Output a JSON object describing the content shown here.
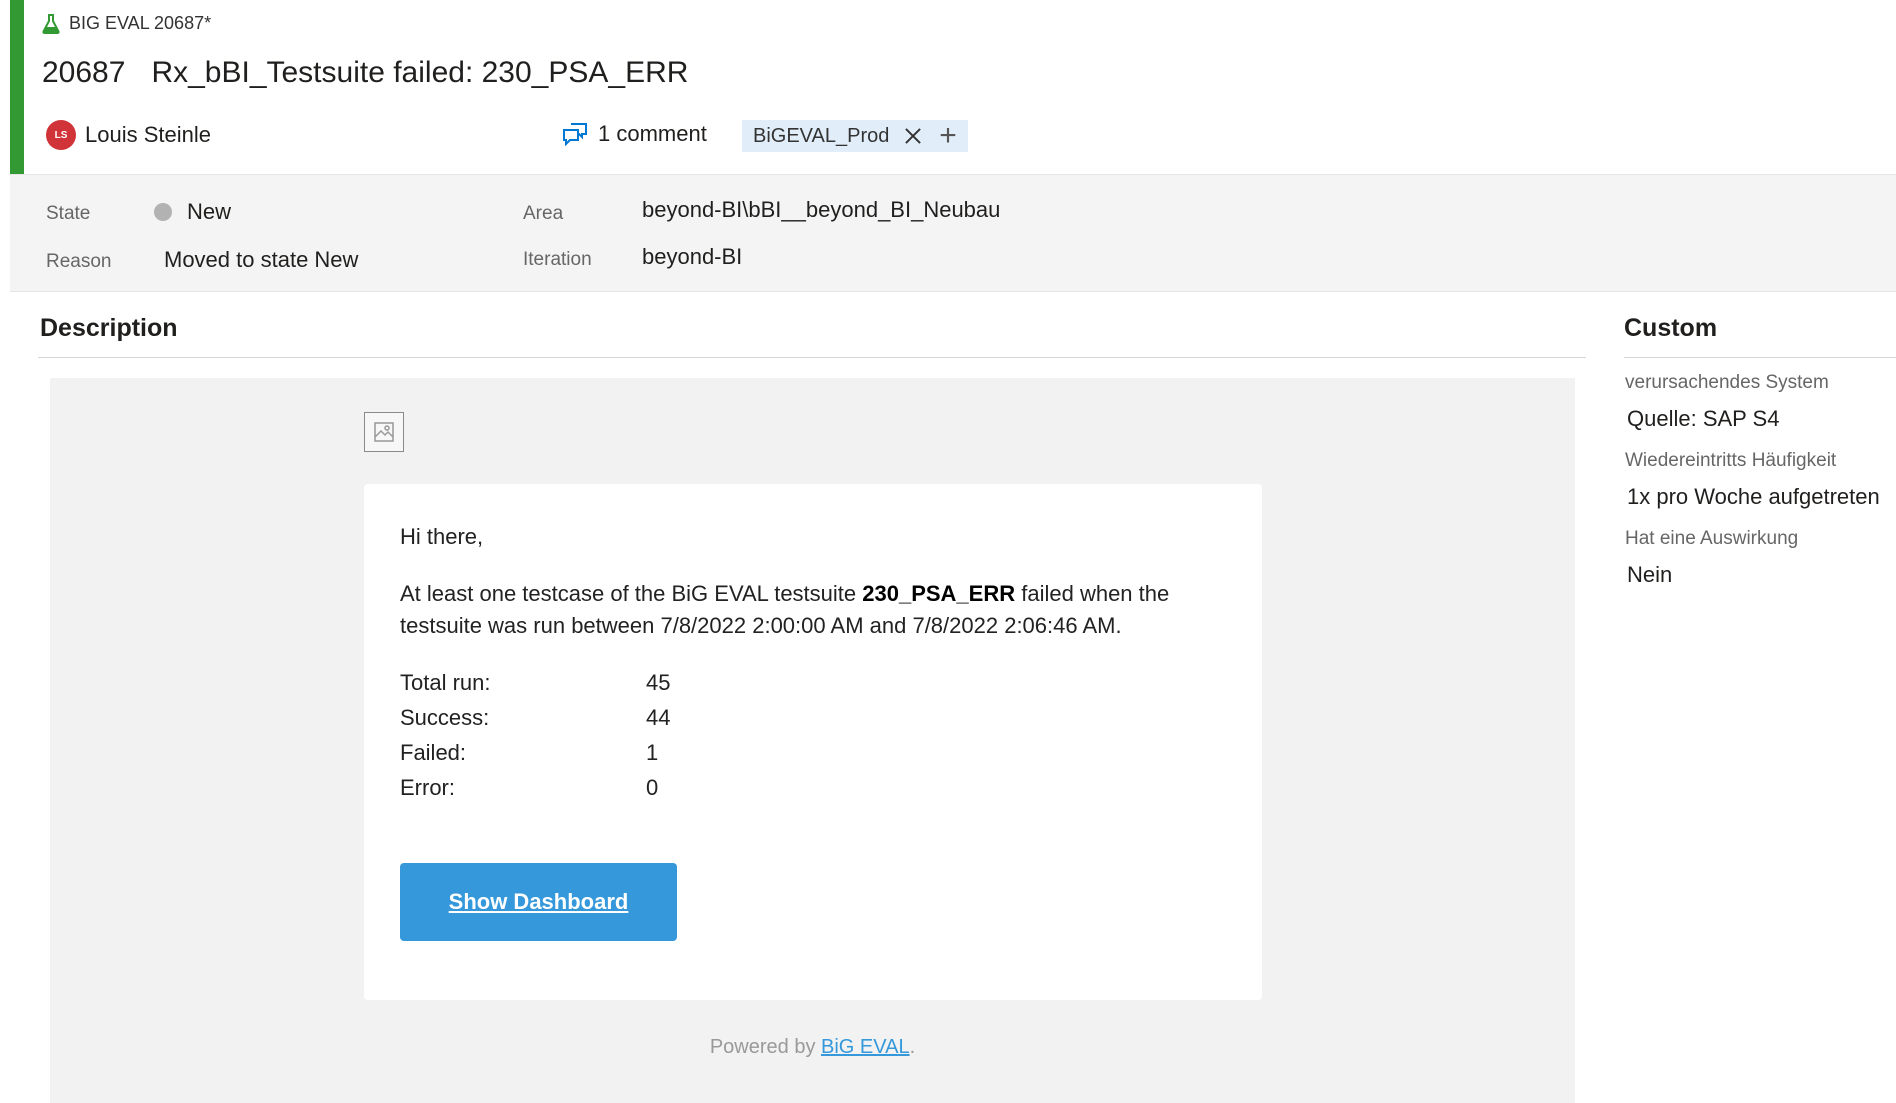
{
  "header": {
    "work_item_type_label": "BIG EVAL 20687*",
    "id": "20687",
    "title": "Rx_bBI_Testsuite failed: 230_PSA_ERR",
    "assignee_initials": "LS",
    "assignee": "Louis Steinle",
    "comments_label": "1 comment",
    "tags": [
      "BiGEVAL_Prod"
    ],
    "add_tag_label": "+"
  },
  "fields": {
    "state_label": "State",
    "state_value": "New",
    "reason_label": "Reason",
    "reason_value": "Moved to state New",
    "area_label": "Area",
    "area_value": "beyond-BI\\bBI__beyond_BI_Neubau",
    "iteration_label": "Iteration",
    "iteration_value": "beyond-BI"
  },
  "description": {
    "section_title": "Description",
    "greeting": "Hi there,",
    "summary_pre": "At least one testcase of the BiG EVAL testsuite ",
    "summary_bold": "230_PSA_ERR",
    "summary_post": " failed when the testsuite was run between 7/8/2022 2:00:00 AM and 7/8/2022 2:06:46 AM.",
    "stats": [
      {
        "label": "Total run:",
        "value": "45"
      },
      {
        "label": "Success:",
        "value": "44"
      },
      {
        "label": "Failed:",
        "value": "1"
      },
      {
        "label": "Error:",
        "value": "0"
      }
    ],
    "button_label": "Show Dashboard",
    "powered_prefix": "Powered by ",
    "powered_link": "BiG EVAL",
    "powered_suffix": "."
  },
  "custom": {
    "section_title": "Custom",
    "fields": [
      {
        "label": "verursachendes System",
        "value": "Quelle: SAP S4"
      },
      {
        "label": "Wiedereintritts Häufigkeit",
        "value": "1x pro Woche aufgetreten"
      },
      {
        "label": "Hat eine Auswirkung",
        "value": "Nein"
      }
    ]
  },
  "colors": {
    "accent": "#339933",
    "avatar": "#d13438",
    "button": "#3498db",
    "tag_bg": "#e1eefa"
  },
  "icons": {
    "type": "flask-icon",
    "comment": "comment-icon",
    "broken_image": "image-icon",
    "tag_remove": "close-icon"
  }
}
